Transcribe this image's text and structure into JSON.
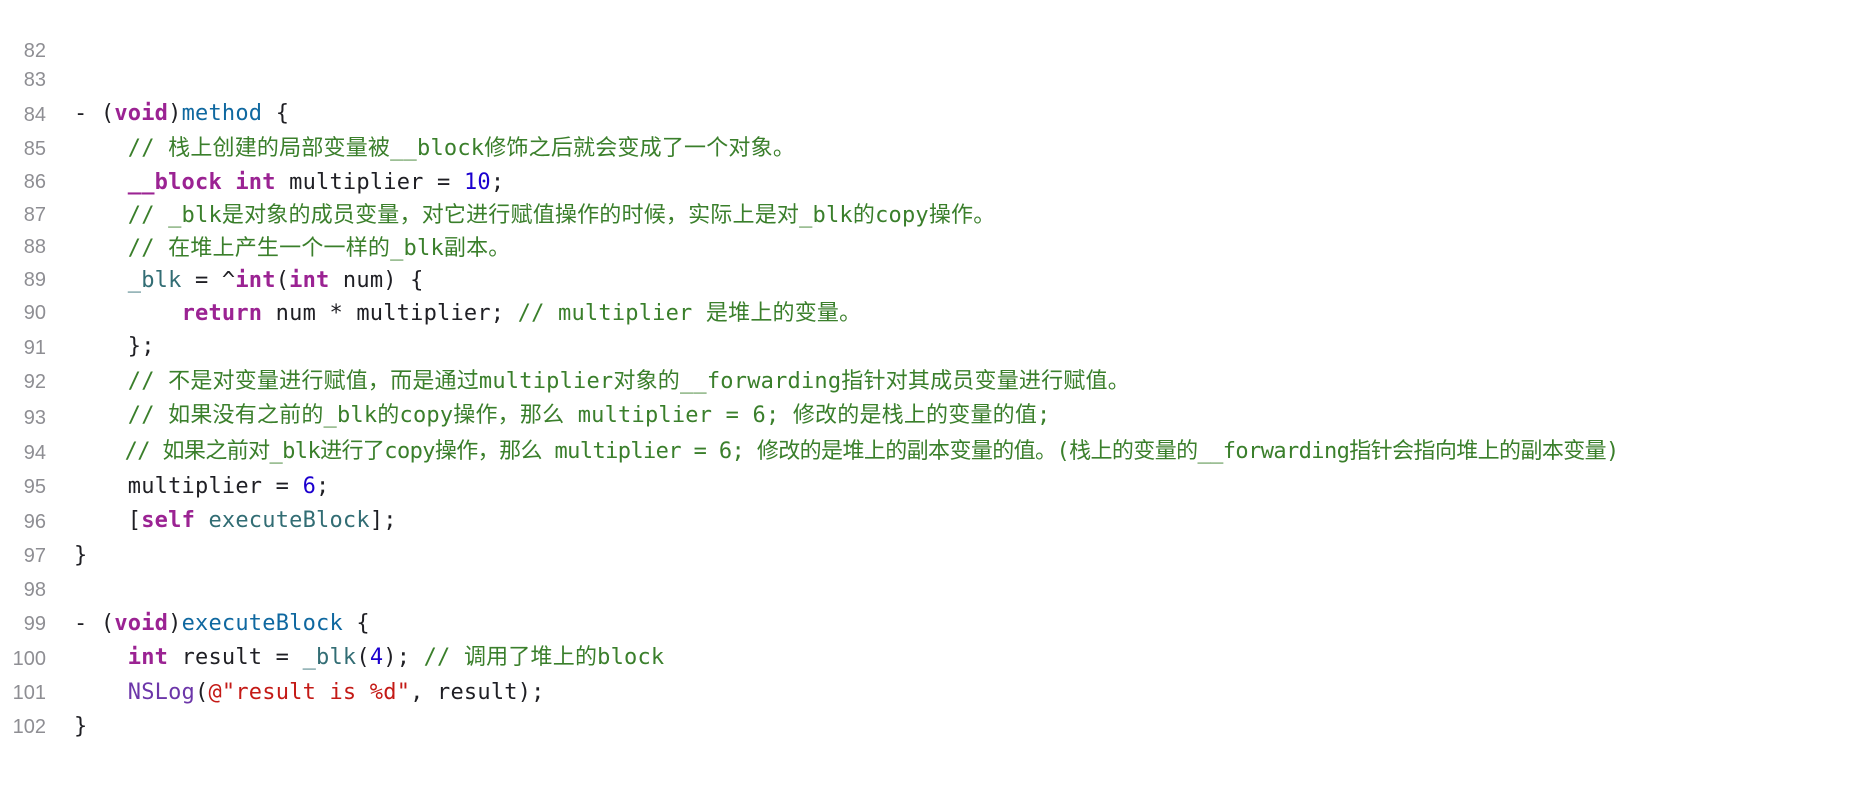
{
  "editor": {
    "lines": [
      {
        "n": "82"
      },
      {
        "n": "83",
        "t": [
          "- (",
          "void",
          ")",
          "method",
          " {"
        ]
      },
      {
        "n": "84",
        "t": [
          "    // 栈上创建的局部变量被__block修饰之后就会变成了一个对象。"
        ]
      },
      {
        "n": "85",
        "t": [
          "    ",
          "__block",
          " ",
          "int",
          " multiplier = ",
          "10",
          ";"
        ]
      },
      {
        "n": "86",
        "t": [
          "    // _blk是对象的成员变量，对它进行赋值操作的时候，实际上是对_blk的copy操作。"
        ]
      },
      {
        "n": "87",
        "t": [
          "    // 在堆上产生一个一样的_blk副本。"
        ]
      },
      {
        "n": "88",
        "t": [
          "    ",
          "_blk",
          " = ^",
          "int",
          "(",
          "int",
          " num) {"
        ]
      },
      {
        "n": "89",
        "t": [
          "        ",
          "return",
          " num * multiplier; ",
          "// multiplier 是堆上的变量。"
        ]
      },
      {
        "n": "90",
        "t": [
          "    };"
        ]
      },
      {
        "n": "91",
        "t": [
          "    // 不是对变量进行赋值，而是通过multiplier对象的__forwarding指针对其成员变量进行赋值。"
        ]
      },
      {
        "n": "92",
        "t": [
          "    // 如果没有之前的_blk的copy操作，那么 multiplier = 6; 修改的是栈上的变量的值;"
        ]
      },
      {
        "n": "93",
        "t": [
          "    // 如果之前对_blk进行了copy操作，那么 multiplier = 6; 修改的是堆上的副本变量的值。(栈上的变量的__forwarding指针会指向堆上的副本变量)"
        ]
      },
      {
        "n": "94",
        "t": [
          "    multiplier = ",
          "6",
          ";"
        ]
      },
      {
        "n": "95",
        "t": [
          "    [",
          "self",
          " ",
          "executeBlock",
          "];"
        ]
      },
      {
        "n": "96",
        "t": [
          "}"
        ]
      },
      {
        "n": "97"
      },
      {
        "n": "98",
        "t": [
          "- (",
          "void",
          ")",
          "executeBlock",
          " {"
        ]
      },
      {
        "n": "99",
        "t": [
          "    ",
          "int",
          " result = ",
          "_blk",
          "(",
          "4",
          "); ",
          "// 调用了堆上的block"
        ]
      },
      {
        "n": "100",
        "t": [
          "    ",
          "NSLog",
          "(",
          "@\"result is %d\"",
          ", result);"
        ]
      },
      {
        "n": "101",
        "t": [
          "}"
        ]
      },
      {
        "n": "102"
      }
    ]
  },
  "colors": {
    "background": "#ffffff",
    "line_number": "#8e8e93",
    "plain": "#1f1f24",
    "keyword": "#9b2393",
    "comment": "#3a7f2b",
    "number": "#1c00cf",
    "string": "#c41a16",
    "identifier": "#326d74",
    "class": "#6c36a9",
    "method_decl": "#0f68a0"
  }
}
